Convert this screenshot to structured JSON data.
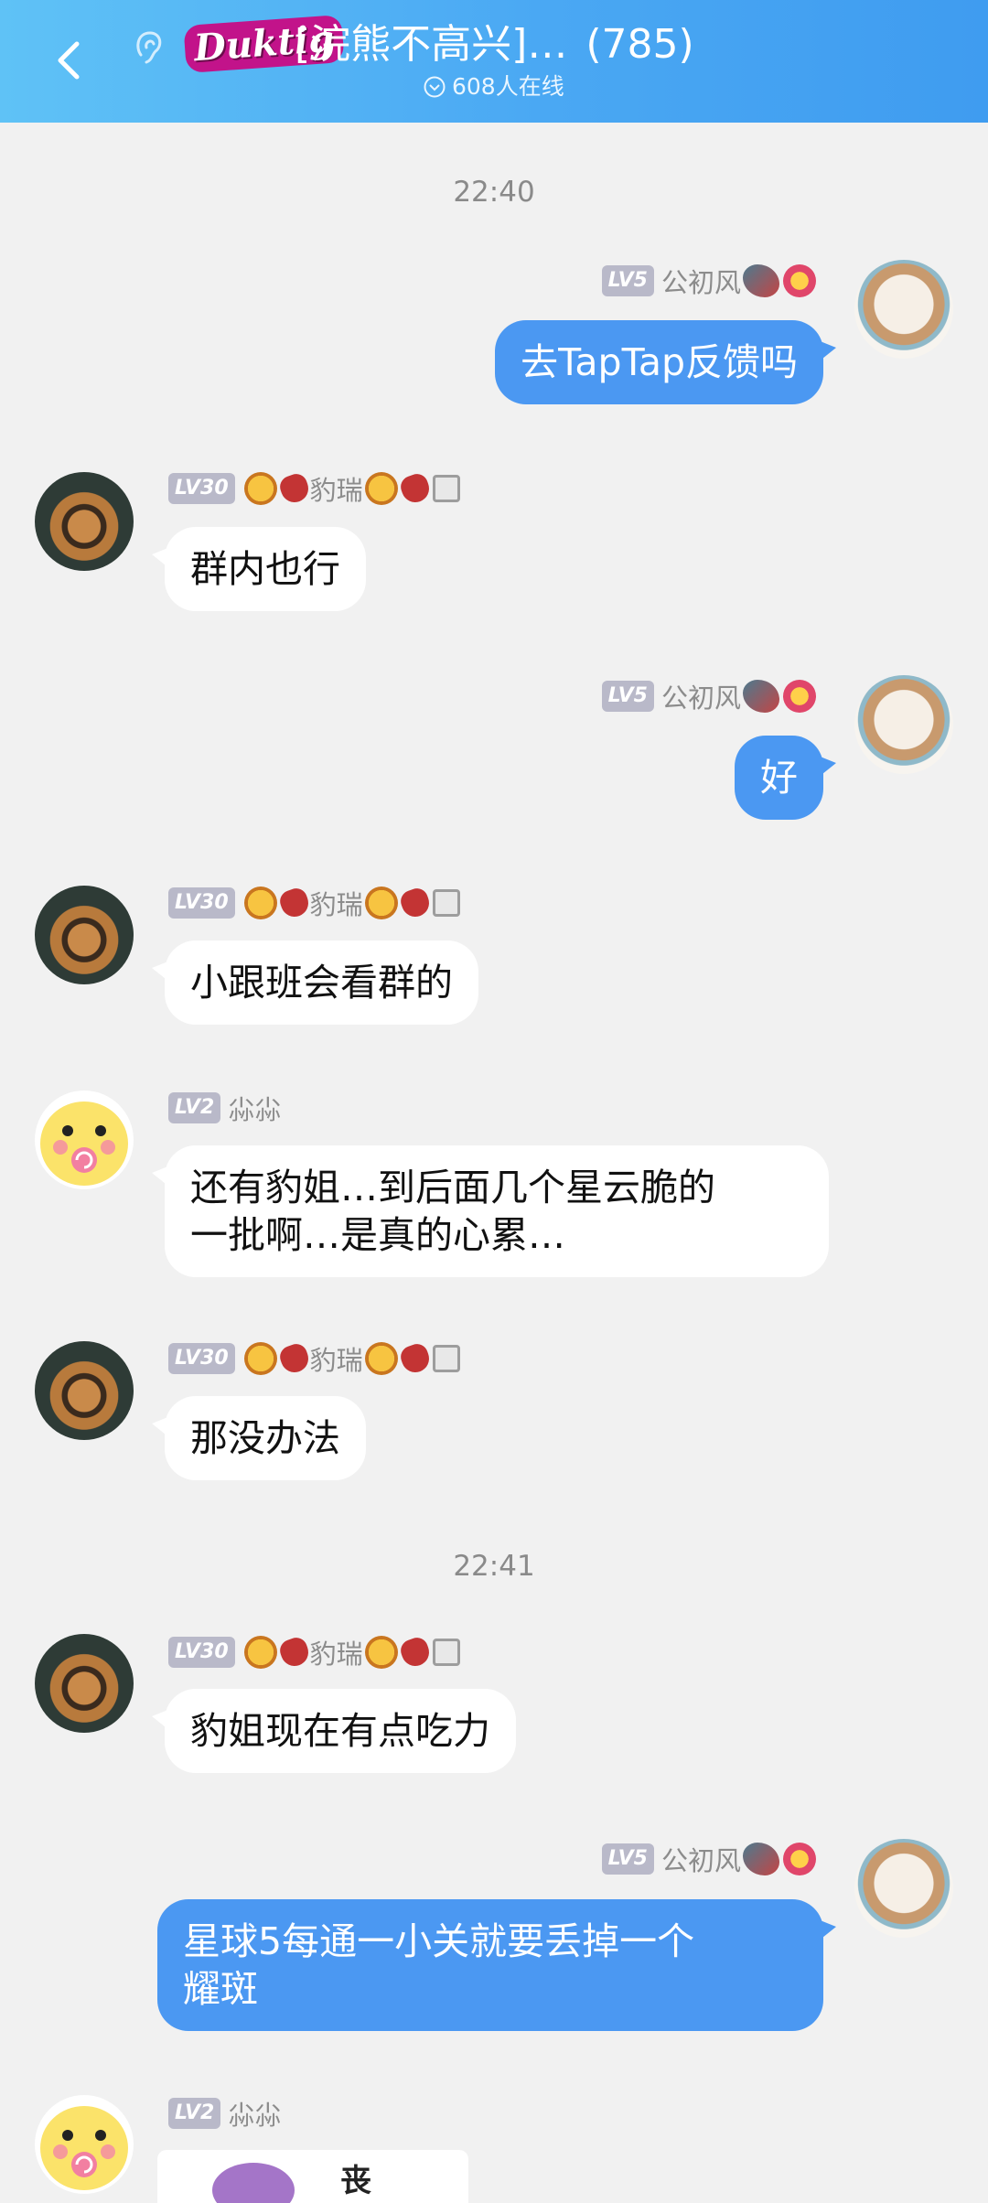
{
  "header": {
    "brand_logo": "Duktig",
    "title": "[浣熊不高兴]…",
    "member_count": "(785)",
    "online_text": "608人在线"
  },
  "timestamps": [
    "22:40",
    "22:41"
  ],
  "messages": [
    {
      "side": "right",
      "level": "LV5",
      "name": "公初风",
      "text": "去TapTap反馈吗"
    },
    {
      "side": "left",
      "level": "LV30",
      "name": "豹瑞",
      "text": "群内也行"
    },
    {
      "side": "right",
      "level": "LV5",
      "name": "公初风",
      "text": "好"
    },
    {
      "side": "left",
      "level": "LV30",
      "name": "豹瑞",
      "text": "小跟班会看群的"
    },
    {
      "side": "left",
      "level": "LV2",
      "name": "尛尛",
      "text_line1": "还有豹姐…到后面几个星云脆的",
      "text_line2": "一批啊…是真的心累…"
    },
    {
      "side": "left",
      "level": "LV30",
      "name": "豹瑞",
      "text": "那没办法"
    },
    {
      "side": "left",
      "level": "LV30",
      "name": "豹瑞",
      "text": "豹姐现在有点吃力"
    },
    {
      "side": "right",
      "level": "LV5",
      "name": "公初风",
      "text_line1": "星球5每通一小关就要丢掉一个",
      "text_line2": "耀斑"
    },
    {
      "side": "left",
      "level": "LV2",
      "name": "尛尛",
      "sticker_text": "丧"
    }
  ],
  "colors": {
    "header_start": "#5fc2f6",
    "header_end": "#3f9cf0",
    "bubble_self": "#4b98f2",
    "bubble_other": "#ffffff",
    "background": "#f1f1f1"
  }
}
